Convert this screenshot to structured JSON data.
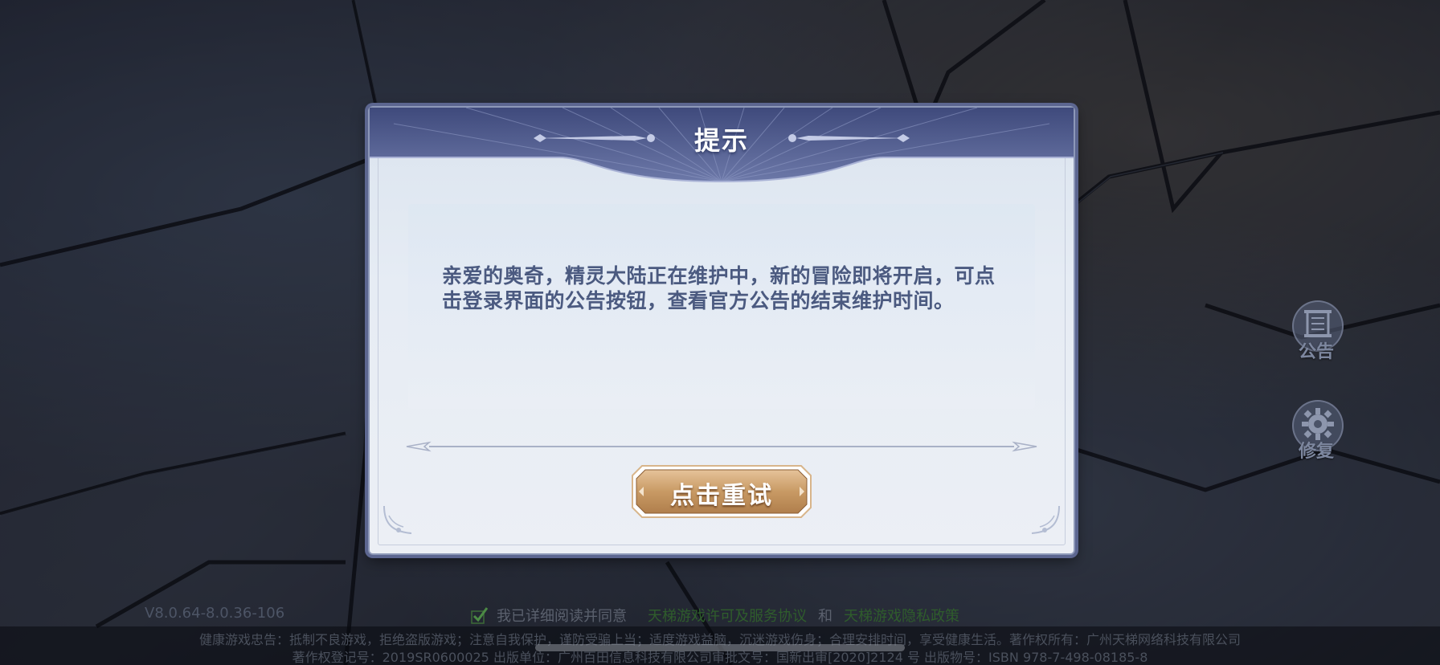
{
  "dialog": {
    "title": "提示",
    "message": "亲爱的奥奇，精灵大陆正在维护中，新的冒险即将开启，可点击登录界面的公告按钮，查看官方公告的结束维护时间。",
    "retry_button": "点击重试"
  },
  "side_buttons": {
    "announcement_label": "公告",
    "announcement_icon": "scroll-icon",
    "repair_label": "修复",
    "repair_icon": "gear-icon"
  },
  "footer": {
    "version": "V8.0.64-8.0.36-106",
    "agree_text": "我已详细阅读并同意",
    "license_link": "天梯游戏许可及服务协议",
    "and": "和",
    "privacy_link": "天梯游戏隐私政策",
    "health_notice": "健康游戏忠告：抵制不良游戏，拒绝盗版游戏；注意自我保护，谨防受骗上当；适度游戏益脑，沉迷游戏伤身；合理安排时间，享受健康生活。著作权所有：广州天梯网络科技有限公司",
    "registration": "著作权登记号：2019SR0600025 出版单位：广州百田信息科技有限公司审批文号：国新出审[2020]2124 号 出版物号：ISBN 978-7-498-08185-8"
  },
  "colors": {
    "dialog_header": "#4e5a8e",
    "message_text": "#4b5a80",
    "button_gold": "#c89a64",
    "link_green": "#2f5d2c"
  }
}
